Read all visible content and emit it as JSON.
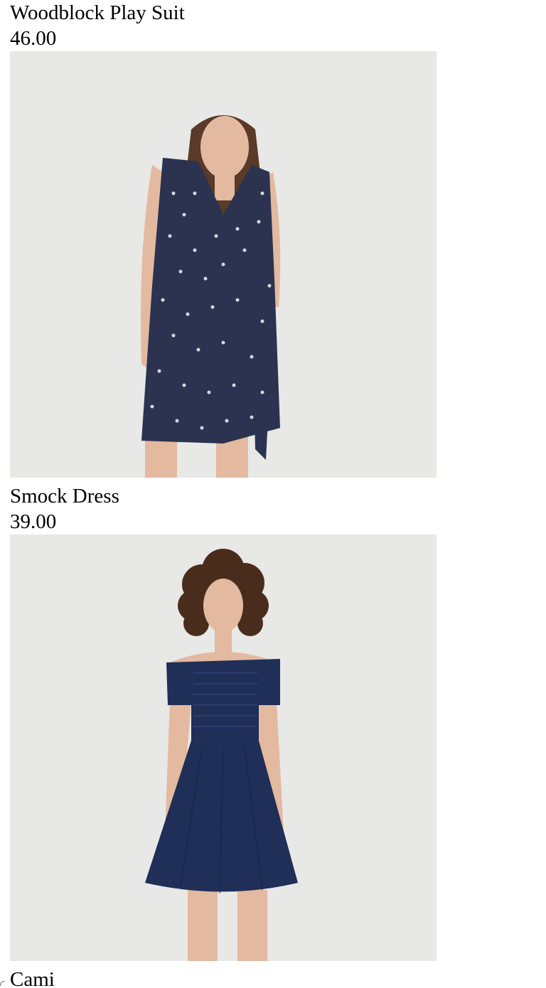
{
  "products": [
    {
      "name": "Woodblock Play Suit",
      "price": "46.00",
      "image_alt": "Woodblock Play Suit",
      "garment_color": "#2b3350",
      "print_color": "#e9e9ef"
    },
    {
      "name": "Smock Dress",
      "price": "39.00",
      "image_alt": "Smock Dress",
      "garment_color": "#1f2f57"
    },
    {
      "name": "Cami"
    }
  ],
  "colors": {
    "photo_background": "#e8e8e6",
    "skin": "#e3b9a0",
    "hair_straight": "#5a3a28",
    "hair_curly": "#4a2c1d"
  }
}
